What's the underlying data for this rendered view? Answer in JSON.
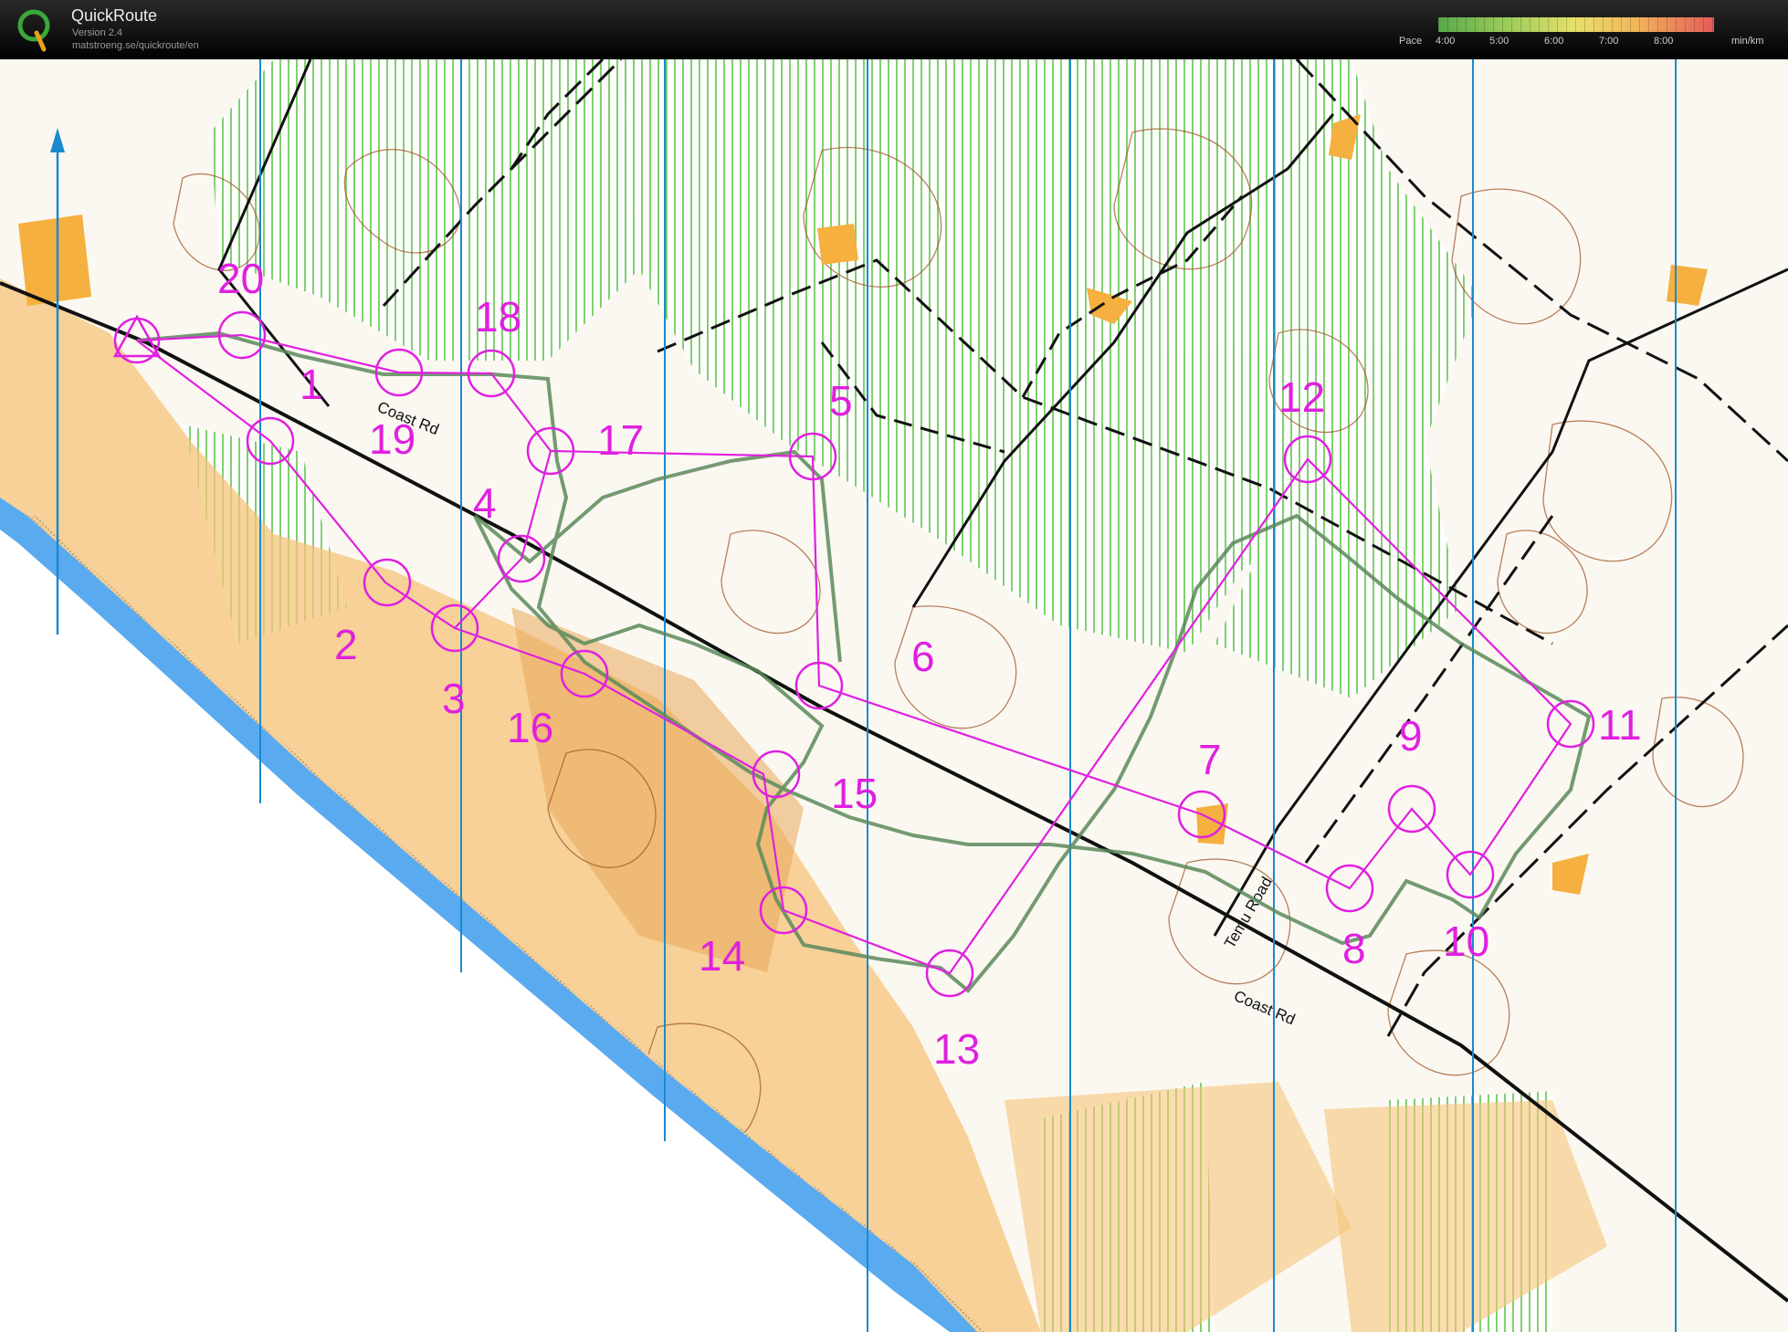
{
  "app": {
    "title": "QuickRoute",
    "version": "Version 2.4",
    "url": "matstroeng.se/quickroute/en"
  },
  "pace_legend": {
    "label": "Pace",
    "ticks": [
      "4:00",
      "5:00",
      "6:00",
      "7:00",
      "8:00"
    ],
    "unit": "min/km",
    "colors": [
      "#58a84a",
      "#9ccc5a",
      "#e7e06a",
      "#f2b45a",
      "#e45a5a"
    ]
  },
  "map": {
    "road_labels": [
      "Coast Rd",
      "Temu Road",
      "Coast Rd"
    ],
    "controls": [
      "1",
      "2",
      "3",
      "4",
      "5",
      "6",
      "7",
      "8",
      "9",
      "10",
      "11",
      "12",
      "13",
      "14",
      "15",
      "16",
      "17",
      "18",
      "19",
      "20"
    ],
    "course_color": "#e020e0",
    "route_color": "#5a8a5a",
    "north_line_color": "#1a8ad0",
    "water_color": "#5aaaf0"
  }
}
